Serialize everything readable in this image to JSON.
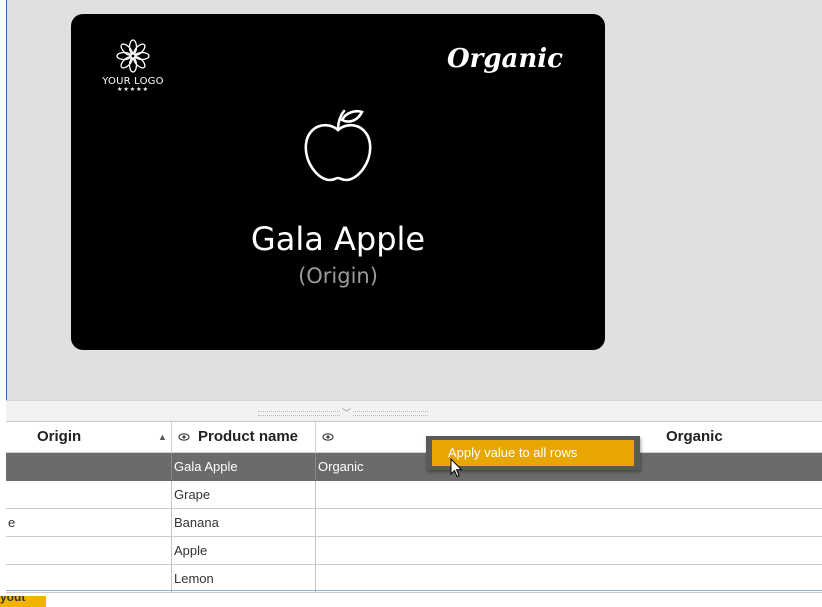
{
  "card": {
    "logo_text": "YOUR LOGO",
    "logo_stars": "★★★★★",
    "badge": "Organic",
    "product_name": "Gala Apple",
    "origin": "(Origin)",
    "icon": "apple-icon"
  },
  "grid": {
    "columns": {
      "origin": "Origin",
      "product_name": "Product name",
      "organic": "Organic"
    },
    "rows": [
      {
        "origin": "",
        "product_name": "Gala Apple",
        "organic": "Organic",
        "selected": true
      },
      {
        "origin": "",
        "product_name": "Grape",
        "organic": ""
      },
      {
        "origin": "e",
        "product_name": "Banana",
        "organic": ""
      },
      {
        "origin": "",
        "product_name": "Apple",
        "organic": ""
      },
      {
        "origin": "",
        "product_name": "Lemon",
        "organic": ""
      }
    ]
  },
  "context_menu": {
    "apply_all": "Apply value to all rows"
  },
  "footer": {
    "layout_button": "yout"
  },
  "colors": {
    "accent": "#e8a600",
    "card_bg": "#000000",
    "selected_row": "#6b6b6b"
  }
}
